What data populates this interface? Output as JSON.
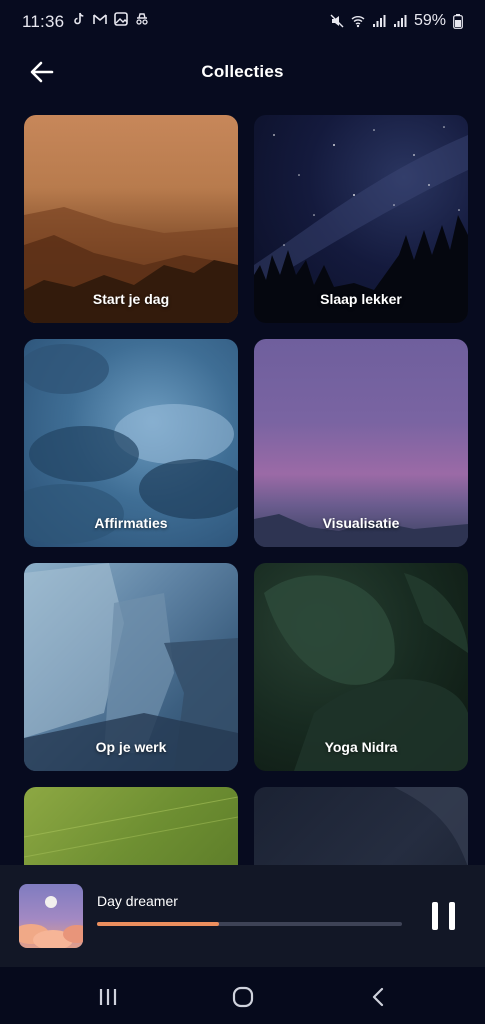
{
  "status_bar": {
    "time": "11:36",
    "battery": "59%"
  },
  "header": {
    "title": "Collecties"
  },
  "collections": [
    {
      "label": "Start je dag"
    },
    {
      "label": "Slaap lekker"
    },
    {
      "label": "Affirmaties"
    },
    {
      "label": "Visualisatie"
    },
    {
      "label": "Op je werk"
    },
    {
      "label": "Yoga Nidra"
    }
  ],
  "player": {
    "track_title": "Day dreamer",
    "progress": 0.4,
    "progress_color": "#ec8f5e"
  },
  "icons": {
    "back": "arrow-left-icon",
    "pause": "pause-icon",
    "nav_recents": "recents-icon",
    "nav_home": "home-icon",
    "nav_back": "chevron-left-icon"
  },
  "colors": {
    "background": "#070b1f",
    "player_bg": "#121726",
    "accent": "#ec8f5e"
  }
}
